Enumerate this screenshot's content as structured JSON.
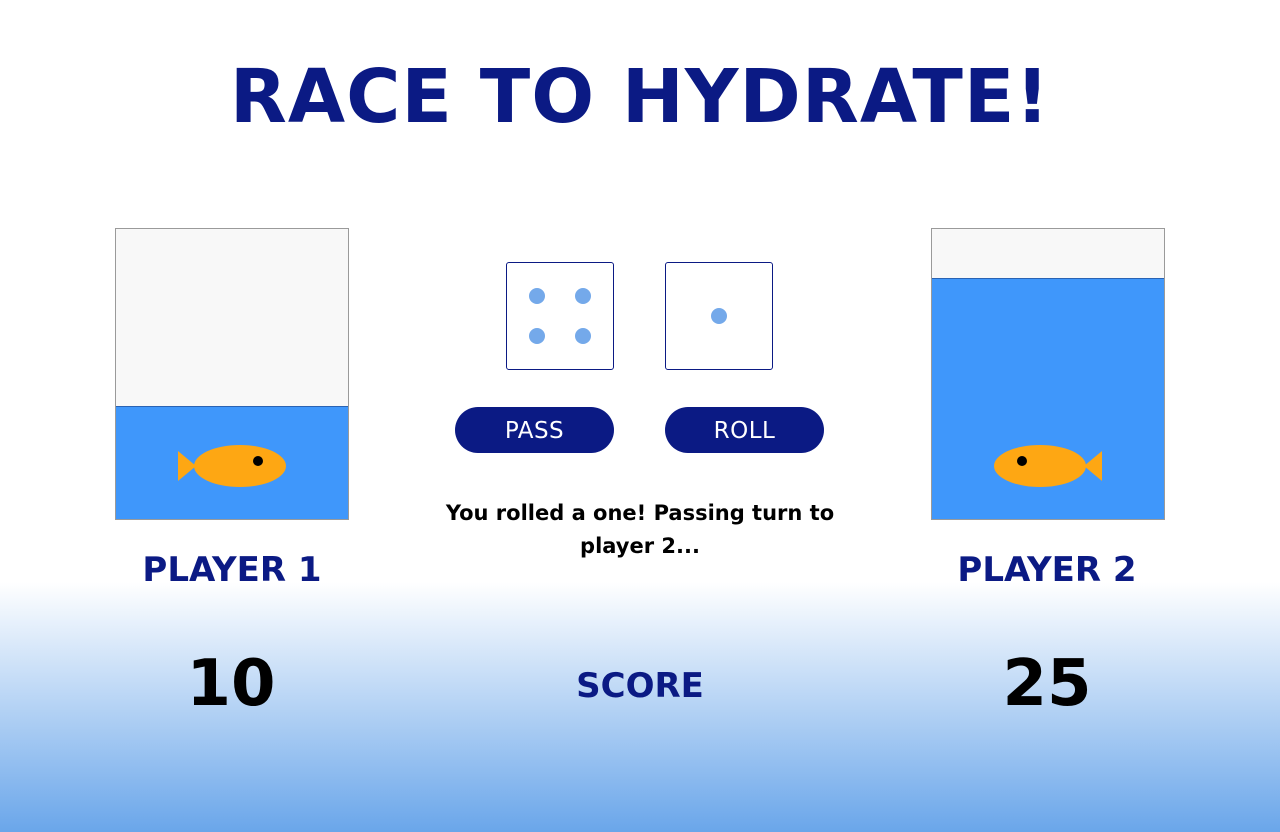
{
  "title": "RACE TO HYDRATE!",
  "players": [
    {
      "label": "PLAYER 1",
      "score": "10",
      "water_level_percent": 38.6
    },
    {
      "label": "PLAYER 2",
      "score": "25",
      "water_level_percent": 82.8
    }
  ],
  "dice": [
    {
      "value": 4
    },
    {
      "value": 1
    }
  ],
  "buttons": {
    "pass_label": "PASS",
    "roll_label": "ROLL"
  },
  "message": "You rolled a one! Passing turn to player 2...",
  "score_label": "SCORE",
  "icons": {
    "fish": "fish-icon"
  },
  "colors": {
    "brand_navy": "#0b1a84",
    "water_blue": "#3f97fb",
    "fish_orange": "#fea713",
    "pip_blue": "#74a9ea"
  }
}
